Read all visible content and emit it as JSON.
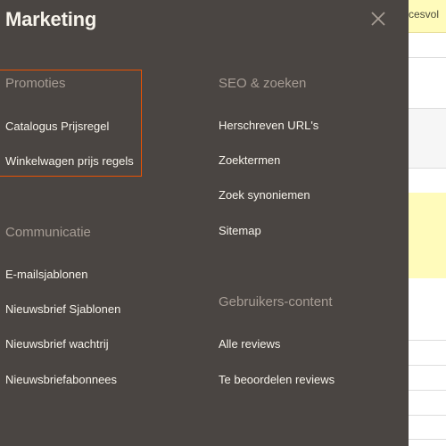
{
  "panel": {
    "title": "Marketing",
    "close_icon": "close-icon"
  },
  "background": {
    "notice_text": "ccesvol",
    "notice_color": "#fffbbb"
  },
  "colors": {
    "panel_bg": "#4a4542",
    "highlight_border": "#eb5202",
    "group_title": "#a79d95",
    "item_text": "#f7f3eb"
  },
  "groups": {
    "promoties": {
      "title": "Promoties",
      "items": [
        "Catalogus Prijsregel",
        "Winkelwagen prijs regels"
      ]
    },
    "communicatie": {
      "title": "Communicatie",
      "items": [
        "E-mailsjablonen",
        "Nieuwsbrief Sjablonen",
        "Nieuwsbrief wachtrij",
        "Nieuwsbriefabonnees"
      ]
    },
    "seo": {
      "title": "SEO & zoeken",
      "items": [
        "Herschreven URL's",
        "Zoektermen",
        "Zoek synoniemen",
        "Sitemap"
      ]
    },
    "ugc": {
      "title": "Gebruikers-content",
      "items": [
        "Alle reviews",
        "Te beoordelen reviews"
      ]
    }
  }
}
